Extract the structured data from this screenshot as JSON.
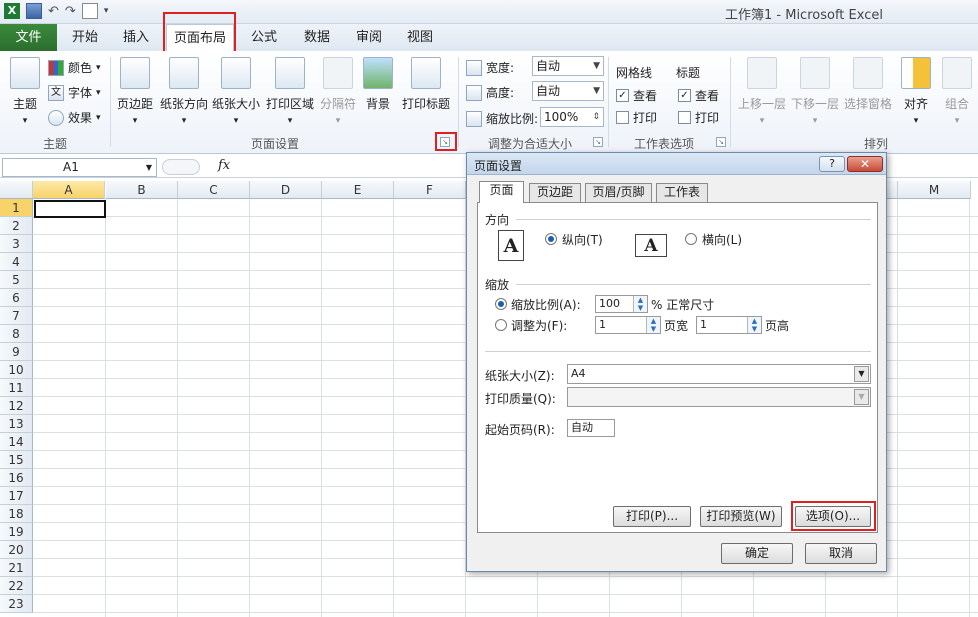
{
  "window": {
    "title": "工作簿1 - Microsoft Excel"
  },
  "tabs": {
    "file": "文件",
    "home": "开始",
    "insert": "插入",
    "page_layout": "页面布局",
    "formulas": "公式",
    "data": "数据",
    "review": "审阅",
    "view": "视图"
  },
  "ribbon": {
    "themes": {
      "themes_btn": "主题",
      "colors": "颜色",
      "fonts": "字体",
      "effects": "效果",
      "label": "主题"
    },
    "page_setup": {
      "margins": "页边距",
      "orientation": "纸张方向",
      "size": "纸张大小",
      "print_area": "打印区域",
      "breaks": "分隔符",
      "background": "背景",
      "print_titles": "打印标题",
      "label": "页面设置"
    },
    "scale": {
      "width": "宽度:",
      "width_value": "自动",
      "height": "高度:",
      "height_value": "自动",
      "scale": "缩放比例:",
      "scale_value": "100%",
      "label": "调整为合适大小"
    },
    "sheet_options": {
      "gridlines": "网格线",
      "headings": "标题",
      "view1": "查看",
      "print1": "打印",
      "view2": "查看",
      "print2": "打印",
      "label": "工作表选项"
    },
    "arrange": {
      "bring_forward": "上移一层",
      "send_backward": "下移一层",
      "selection_pane": "选择窗格",
      "align": "对齐",
      "group": "组合",
      "label": "排列"
    }
  },
  "formula_bar": {
    "name_box": "A1",
    "fx": "fx"
  },
  "grid": {
    "columns": [
      "A",
      "B",
      "C",
      "D",
      "E",
      "F",
      "M"
    ],
    "rows": [
      "1",
      "2",
      "3",
      "4",
      "5",
      "6",
      "7",
      "8",
      "9",
      "10",
      "11",
      "12",
      "13",
      "14",
      "15",
      "16",
      "17",
      "18",
      "19",
      "20",
      "21",
      "22",
      "23"
    ]
  },
  "dialog": {
    "title": "页面设置",
    "help": "?",
    "close": "✕",
    "tabs": [
      "页面",
      "页边距",
      "页眉/页脚",
      "工作表"
    ],
    "orientation_label": "方向",
    "portrait": "纵向(T)",
    "landscape": "横向(L)",
    "page_glyph": "A",
    "scaling_label": "缩放",
    "adjust_to": "缩放比例(A):",
    "adjust_value": "100",
    "percent": "% 正常尺寸",
    "fit_to": "调整为(F):",
    "fit_wide": "1",
    "pages_wide": "页宽",
    "fit_tall": "1",
    "pages_tall": "页高",
    "paper_size_label": "纸张大小(Z):",
    "paper_size": "A4",
    "print_quality_label": "打印质量(Q):",
    "first_page_label": "起始页码(R):",
    "first_page_value": "自动",
    "print_btn": "打印(P)...",
    "preview_btn": "打印预览(W)",
    "options_btn": "选项(O)...",
    "ok": "确定",
    "cancel": "取消"
  },
  "colors": {
    "accent_red": "#e02020",
    "file_green": "#2b6e2e",
    "selected_header": "#f8d36a"
  }
}
